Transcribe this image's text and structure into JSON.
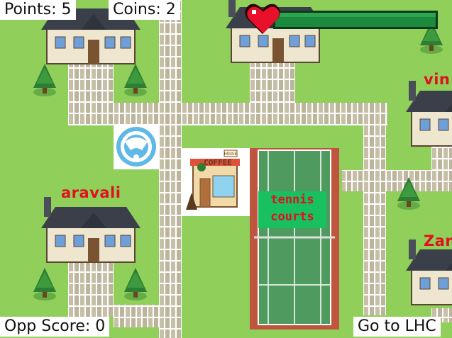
{
  "hud": {
    "points_label": "Points: 5",
    "coins_label": "Coins: 2",
    "opp_score_label": "Opp Score: 0",
    "go_to_lhc_label": "Go to LHC"
  },
  "map": {
    "buildings": [
      {
        "name": "aravali",
        "label": "aravali"
      },
      {
        "name": "vindhyachal",
        "label": "vin"
      },
      {
        "name": "zanskar",
        "label": "Zan"
      }
    ],
    "coffee_shop": {
      "sign": "COFFEE",
      "small_sign": "HOUSE"
    },
    "tennis_courts": {
      "line1": "tennis",
      "line2": "courts"
    }
  },
  "player": {
    "health_fraction": 1.0
  },
  "colors": {
    "grass": "#8fcf5a",
    "path": "#c8bfa8",
    "roof": "#3b3f4a",
    "label_red": "#e01020",
    "court_green": "#4f9a5e",
    "court_border": "#c0553f",
    "heart": "#e8102a",
    "health_green": "#1c8a3c"
  }
}
